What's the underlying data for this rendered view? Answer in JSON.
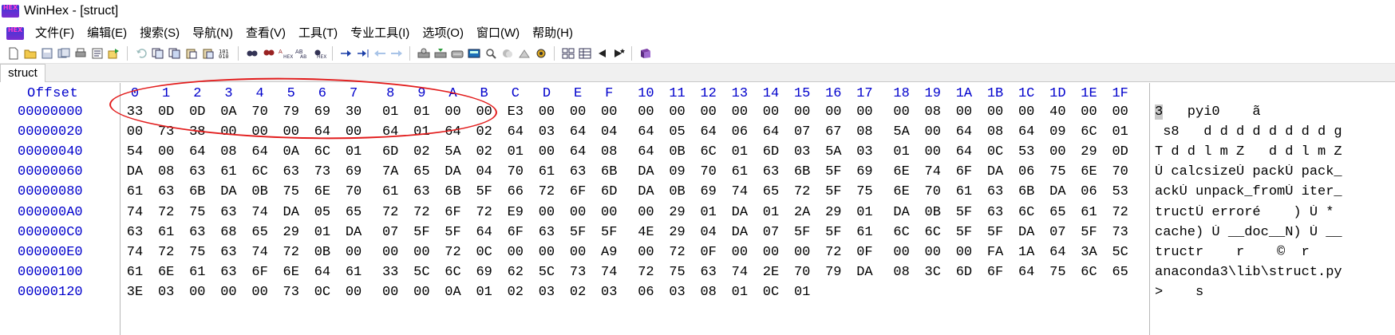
{
  "window": {
    "title": "WinHex - [struct]",
    "logo_text": "HEX"
  },
  "menu": {
    "items": [
      "文件(F)",
      "编辑(E)",
      "搜索(S)",
      "导航(N)",
      "查看(V)",
      "工具(T)",
      "专业工具(I)",
      "选项(O)",
      "窗口(W)",
      "帮助(H)"
    ]
  },
  "tab": {
    "label": "struct"
  },
  "hex_view": {
    "offset_header": "Offset",
    "columns": [
      "0",
      "1",
      "2",
      "3",
      "4",
      "5",
      "6",
      "7",
      "8",
      "9",
      "A",
      "B",
      "C",
      "D",
      "E",
      "F",
      "10",
      "11",
      "12",
      "13",
      "14",
      "15",
      "16",
      "17",
      "18",
      "19",
      "1A",
      "1B",
      "1C",
      "1D",
      "1E",
      "1F"
    ],
    "rows": [
      {
        "offset": "00000000",
        "bytes": [
          "33",
          "0D",
          "0D",
          "0A",
          "70",
          "79",
          "69",
          "30",
          "01",
          "01",
          "00",
          "00",
          "E3",
          "00",
          "00",
          "00",
          "00",
          "00",
          "00",
          "00",
          "00",
          "00",
          "00",
          "00",
          "00",
          "08",
          "00",
          "00",
          "00",
          "40",
          "00",
          "00"
        ],
        "ascii_caret": "3",
        "ascii_rest": "   pyi0    ã"
      },
      {
        "offset": "00000020",
        "bytes": [
          "00",
          "73",
          "38",
          "00",
          "00",
          "00",
          "64",
          "00",
          "64",
          "01",
          "64",
          "02",
          "64",
          "03",
          "64",
          "04",
          "64",
          "05",
          "64",
          "06",
          "64",
          "07",
          "67",
          "08",
          "5A",
          "00",
          "64",
          "08",
          "64",
          "09",
          "6C",
          "01"
        ],
        "ascii_caret": "",
        "ascii_rest": " s8   d d d d d d d d g"
      },
      {
        "offset": "00000040",
        "bytes": [
          "54",
          "00",
          "64",
          "08",
          "64",
          "0A",
          "6C",
          "01",
          "6D",
          "02",
          "5A",
          "02",
          "01",
          "00",
          "64",
          "08",
          "64",
          "0B",
          "6C",
          "01",
          "6D",
          "03",
          "5A",
          "03",
          "01",
          "00",
          "64",
          "0C",
          "53",
          "00",
          "29",
          "0D"
        ],
        "ascii_caret": "",
        "ascii_rest": "T d d l m Z   d d l m Z"
      },
      {
        "offset": "00000060",
        "bytes": [
          "DA",
          "08",
          "63",
          "61",
          "6C",
          "63",
          "73",
          "69",
          "7A",
          "65",
          "DA",
          "04",
          "70",
          "61",
          "63",
          "6B",
          "DA",
          "09",
          "70",
          "61",
          "63",
          "6B",
          "5F",
          "69",
          "6E",
          "74",
          "6F",
          "DA",
          "06",
          "75",
          "6E",
          "70"
        ],
        "ascii_caret": "",
        "ascii_rest": "Ú calcsizeÚ packÚ pack_"
      },
      {
        "offset": "00000080",
        "bytes": [
          "61",
          "63",
          "6B",
          "DA",
          "0B",
          "75",
          "6E",
          "70",
          "61",
          "63",
          "6B",
          "5F",
          "66",
          "72",
          "6F",
          "6D",
          "DA",
          "0B",
          "69",
          "74",
          "65",
          "72",
          "5F",
          "75",
          "6E",
          "70",
          "61",
          "63",
          "6B",
          "DA",
          "06",
          "53"
        ],
        "ascii_caret": "",
        "ascii_rest": "ackÚ unpack_fromÚ iter_"
      },
      {
        "offset": "000000A0",
        "bytes": [
          "74",
          "72",
          "75",
          "63",
          "74",
          "DA",
          "05",
          "65",
          "72",
          "72",
          "6F",
          "72",
          "E9",
          "00",
          "00",
          "00",
          "00",
          "29",
          "01",
          "DA",
          "01",
          "2A",
          "29",
          "01",
          "DA",
          "0B",
          "5F",
          "63",
          "6C",
          "65",
          "61",
          "72"
        ],
        "ascii_caret": "",
        "ascii_rest": "tructÚ erroré    ) Ú *"
      },
      {
        "offset": "000000C0",
        "bytes": [
          "63",
          "61",
          "63",
          "68",
          "65",
          "29",
          "01",
          "DA",
          "07",
          "5F",
          "5F",
          "64",
          "6F",
          "63",
          "5F",
          "5F",
          "4E",
          "29",
          "04",
          "DA",
          "07",
          "5F",
          "5F",
          "61",
          "6C",
          "6C",
          "5F",
          "5F",
          "DA",
          "07",
          "5F",
          "73"
        ],
        "ascii_caret": "",
        "ascii_rest": "cache) Ú __doc__N) Ú __"
      },
      {
        "offset": "000000E0",
        "bytes": [
          "74",
          "72",
          "75",
          "63",
          "74",
          "72",
          "0B",
          "00",
          "00",
          "00",
          "72",
          "0C",
          "00",
          "00",
          "00",
          "A9",
          "00",
          "72",
          "0F",
          "00",
          "00",
          "00",
          "72",
          "0F",
          "00",
          "00",
          "00",
          "FA",
          "1A",
          "64",
          "3A",
          "5C"
        ],
        "ascii_caret": "",
        "ascii_rest": "tructr    r    ©  r"
      },
      {
        "offset": "00000100",
        "bytes": [
          "61",
          "6E",
          "61",
          "63",
          "6F",
          "6E",
          "64",
          "61",
          "33",
          "5C",
          "6C",
          "69",
          "62",
          "5C",
          "73",
          "74",
          "72",
          "75",
          "63",
          "74",
          "2E",
          "70",
          "79",
          "DA",
          "08",
          "3C",
          "6D",
          "6F",
          "64",
          "75",
          "6C",
          "65"
        ],
        "ascii_caret": "",
        "ascii_rest": "anaconda3\\lib\\struct.py"
      },
      {
        "offset": "00000120",
        "bytes": [
          "3E",
          "03",
          "00",
          "00",
          "00",
          "73",
          "0C",
          "00",
          "00",
          "00",
          "0A",
          "01",
          "02",
          "03",
          "02",
          "03",
          "06",
          "03",
          "08",
          "01",
          "0C",
          "01"
        ],
        "ascii_caret": "",
        "ascii_rest": ">    s"
      }
    ]
  },
  "annotation": {
    "color": "#e21b1b"
  },
  "colors": {
    "offset_blue": "#0000cc",
    "caret_gray": "#c8c8c8"
  }
}
